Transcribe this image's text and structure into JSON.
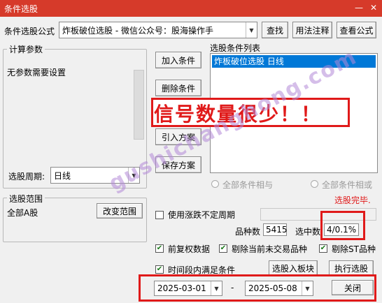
{
  "window": {
    "title": "条件选股",
    "close_glyph": "✕",
    "minimize_glyph": "—"
  },
  "formula": {
    "label": "条件选股公式",
    "selected": "炸板破位选股  -  微信公众号：股海操作手",
    "find_button": "查找",
    "usage_button": "用法注释",
    "view_button": "查看公式"
  },
  "params": {
    "group_label": "计算参数",
    "message": "无参数需要设置",
    "period_label": "选股周期:",
    "period_value": "日线"
  },
  "actions": {
    "add": "加入条件",
    "delete": "删除条件",
    "import": "引入方案",
    "save": "保存方案"
  },
  "conditions": {
    "group_label": "选股条件列表",
    "items": [
      "炸板破位选股  日线"
    ],
    "and_label": "全部条件相与",
    "or_label": "全部条件相或",
    "status": "选股完毕."
  },
  "annotation": {
    "text": "信号数量很少！！"
  },
  "scope": {
    "group_label": "选股范围",
    "value": "全部A股",
    "change_button": "改变范围"
  },
  "options": {
    "use_variable_period": "使用涨跌不定周期",
    "count_label": "品种数",
    "count_value": "5415",
    "selected_label": "选中数",
    "selected_value": "4/0.1%",
    "adjusted": "前复权数据",
    "exclude_untraded": "剔除当前未交易品种",
    "exclude_st": "剔除ST品种",
    "time_range": "时间段内满足条件"
  },
  "buttons": {
    "add_to_block": "选股入板块",
    "execute": "执行选股",
    "close": "关闭"
  },
  "dates": {
    "start": "2025-03-01",
    "separator": "-",
    "end": "2025-05-08"
  },
  "watermark": "gushichanghong.com",
  "colors": {
    "titlebar": "#d63a2a",
    "annotation": "#e01a1a",
    "list_highlight": "#0078d7"
  }
}
